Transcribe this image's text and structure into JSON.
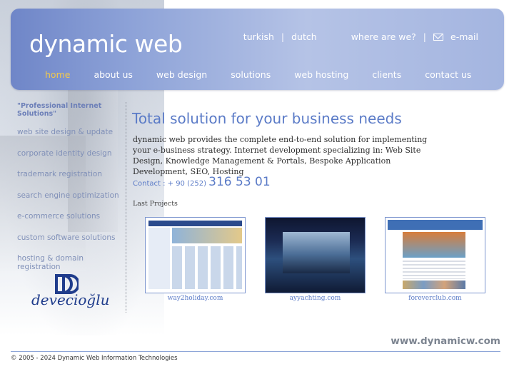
{
  "header": {
    "logo": "dynamic web",
    "lang_turkish": "turkish",
    "lang_dutch": "dutch",
    "where": "where are we?",
    "email": "e-mail",
    "sep": "|"
  },
  "nav": [
    "home",
    "about us",
    "web design",
    "solutions",
    "web hosting",
    "clients",
    "contact us"
  ],
  "sidebar": {
    "tagline": "\"Professional Internet Solutions\"",
    "items": [
      "web site design & update",
      "corporate identity design",
      "trademark registration",
      "search engine optimization",
      "e-commerce solutions",
      "custom software solutions",
      "hosting & domain registration"
    ]
  },
  "partner_logo": "devecioğlu",
  "main": {
    "title": "Total solution for your business needs",
    "description": "dynamic web provides the complete end-to-end solution for implementing your e-business strategy. Internet development specializing in: Web Site Design, Knowledge Management & Portals, Bespoke Application Development, SEO, Hosting",
    "contact_label": "Contact : + 90 (252)",
    "contact_number": "316 53 01",
    "projects_heading": "Last Projects",
    "projects": [
      "way2holiday.com",
      "ayyachting.com",
      "foreverclub.com"
    ]
  },
  "footer": {
    "site": "www.dynamicw.com",
    "copyright": "© 2005 - 2024 Dynamic Web Information Technologies"
  },
  "colors": {
    "accent": "#5b7bc7",
    "nav_active": "#f2c94c",
    "partner_logo": "#1f3c8c"
  }
}
